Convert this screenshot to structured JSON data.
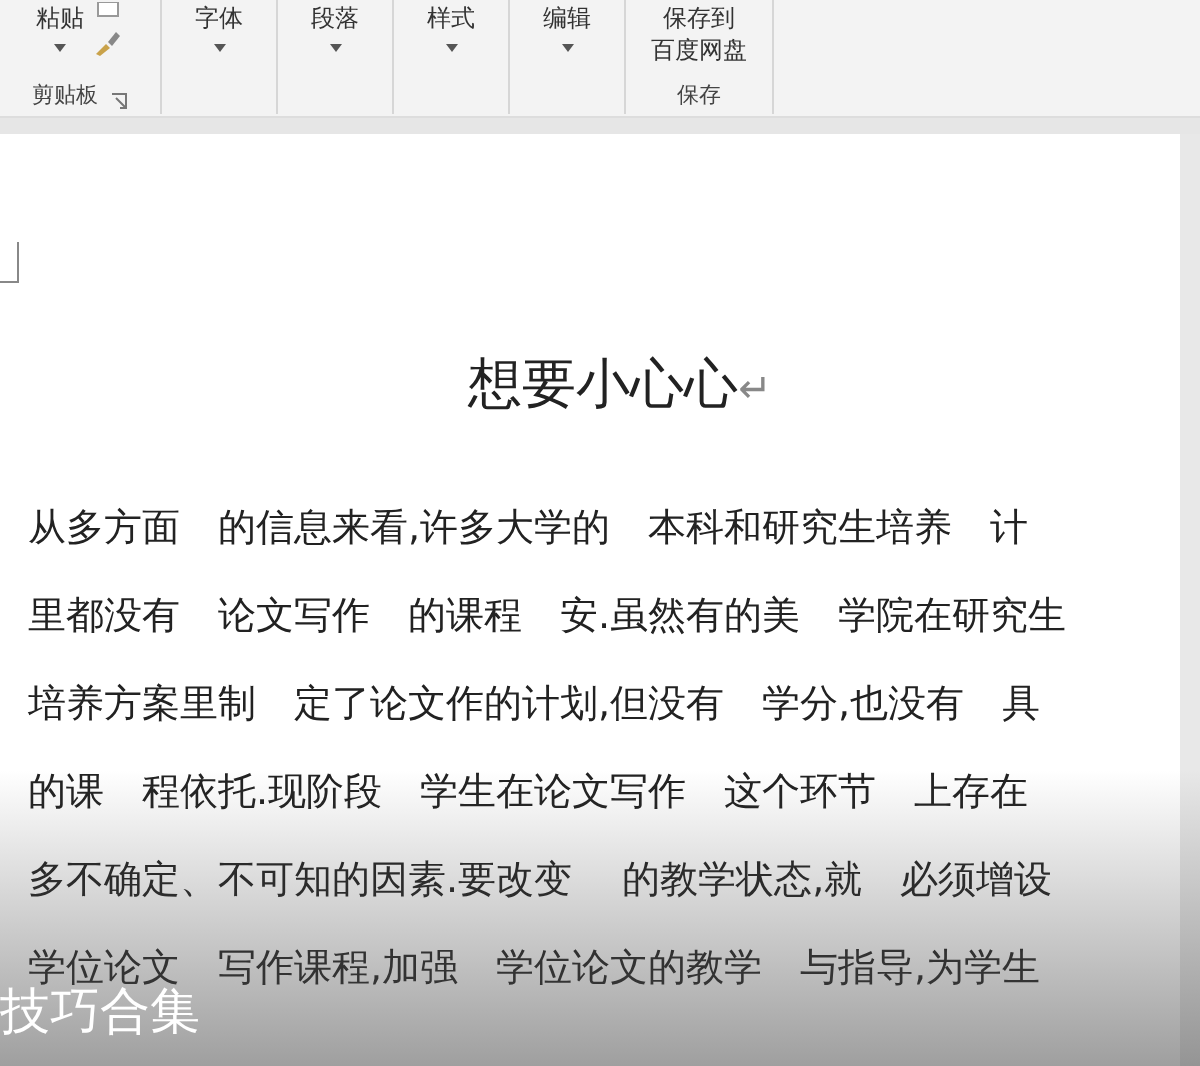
{
  "ribbon": {
    "groups": [
      {
        "kind": "clipboard",
        "button": "粘贴",
        "label": "剪贴板"
      },
      {
        "kind": "dropdown",
        "button": "字体"
      },
      {
        "kind": "dropdown",
        "button": "段落"
      },
      {
        "kind": "dropdown",
        "button": "样式"
      },
      {
        "kind": "dropdown",
        "button": "编辑"
      },
      {
        "kind": "save",
        "button_lines": [
          "保存到",
          "百度网盘"
        ],
        "label": "保存"
      }
    ]
  },
  "document": {
    "title": "想要小心心",
    "paragraph_mark": "↵",
    "lines": [
      "从多方面　的信息来看,许多大学的　本科和研究生培养　计",
      "里都没有　论文写作　的课程　安.虽然有的美　学院在研究生",
      "培养方案里制　定了论文作的计划,但没有　学分,也没有　具",
      "的课　程依托.现阶段　学生在论文写作　这个环节　上存在",
      "多不确定、不可知的因素.要改变　 的教学状态,就　必须增设",
      "学位论文　写作课程,加强　学位论文的教学　与指导,为学生"
    ]
  },
  "overlay": {
    "caption": "技巧合集"
  }
}
